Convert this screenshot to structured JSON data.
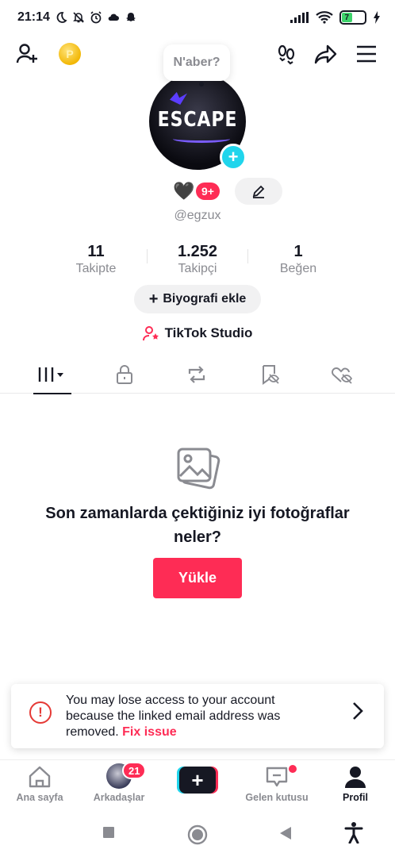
{
  "status_bar": {
    "time": "21:14",
    "battery": "7"
  },
  "bubble": {
    "text": "N'aber?"
  },
  "avatar": {
    "logo_text": "ESCAPE"
  },
  "badge_count": "9+",
  "username": "@egzux",
  "stats": [
    {
      "value": "11",
      "label": "Takipte"
    },
    {
      "value": "1.252",
      "label": "Takipçi"
    },
    {
      "value": "1",
      "label": "Beğen"
    }
  ],
  "bio_button": "Biyografi ekle",
  "studio": "TikTok Studio",
  "tabs": [
    {
      "icon": "grid-icon",
      "active": true
    },
    {
      "icon": "lock-icon"
    },
    {
      "icon": "repost-icon"
    },
    {
      "icon": "bookmark-hidden-icon"
    },
    {
      "icon": "heart-hidden-icon"
    }
  ],
  "empty_state": {
    "title": "Son zamanlarda çektiğiniz iyi fotoğraflar neler?",
    "button": "Yükle"
  },
  "alert": {
    "message": "You may lose access to your account because the linked email address was removed.",
    "link": "Fix issue"
  },
  "bottom_nav": {
    "home": "Ana sayfa",
    "friends": "Arkadaşlar",
    "friends_badge": "21",
    "inbox": "Gelen kutusu",
    "profile": "Profil"
  },
  "colors": {
    "accent": "#fe2c55",
    "cyan": "#20d5ec",
    "text": "#161823",
    "muted": "#8a8b91"
  }
}
